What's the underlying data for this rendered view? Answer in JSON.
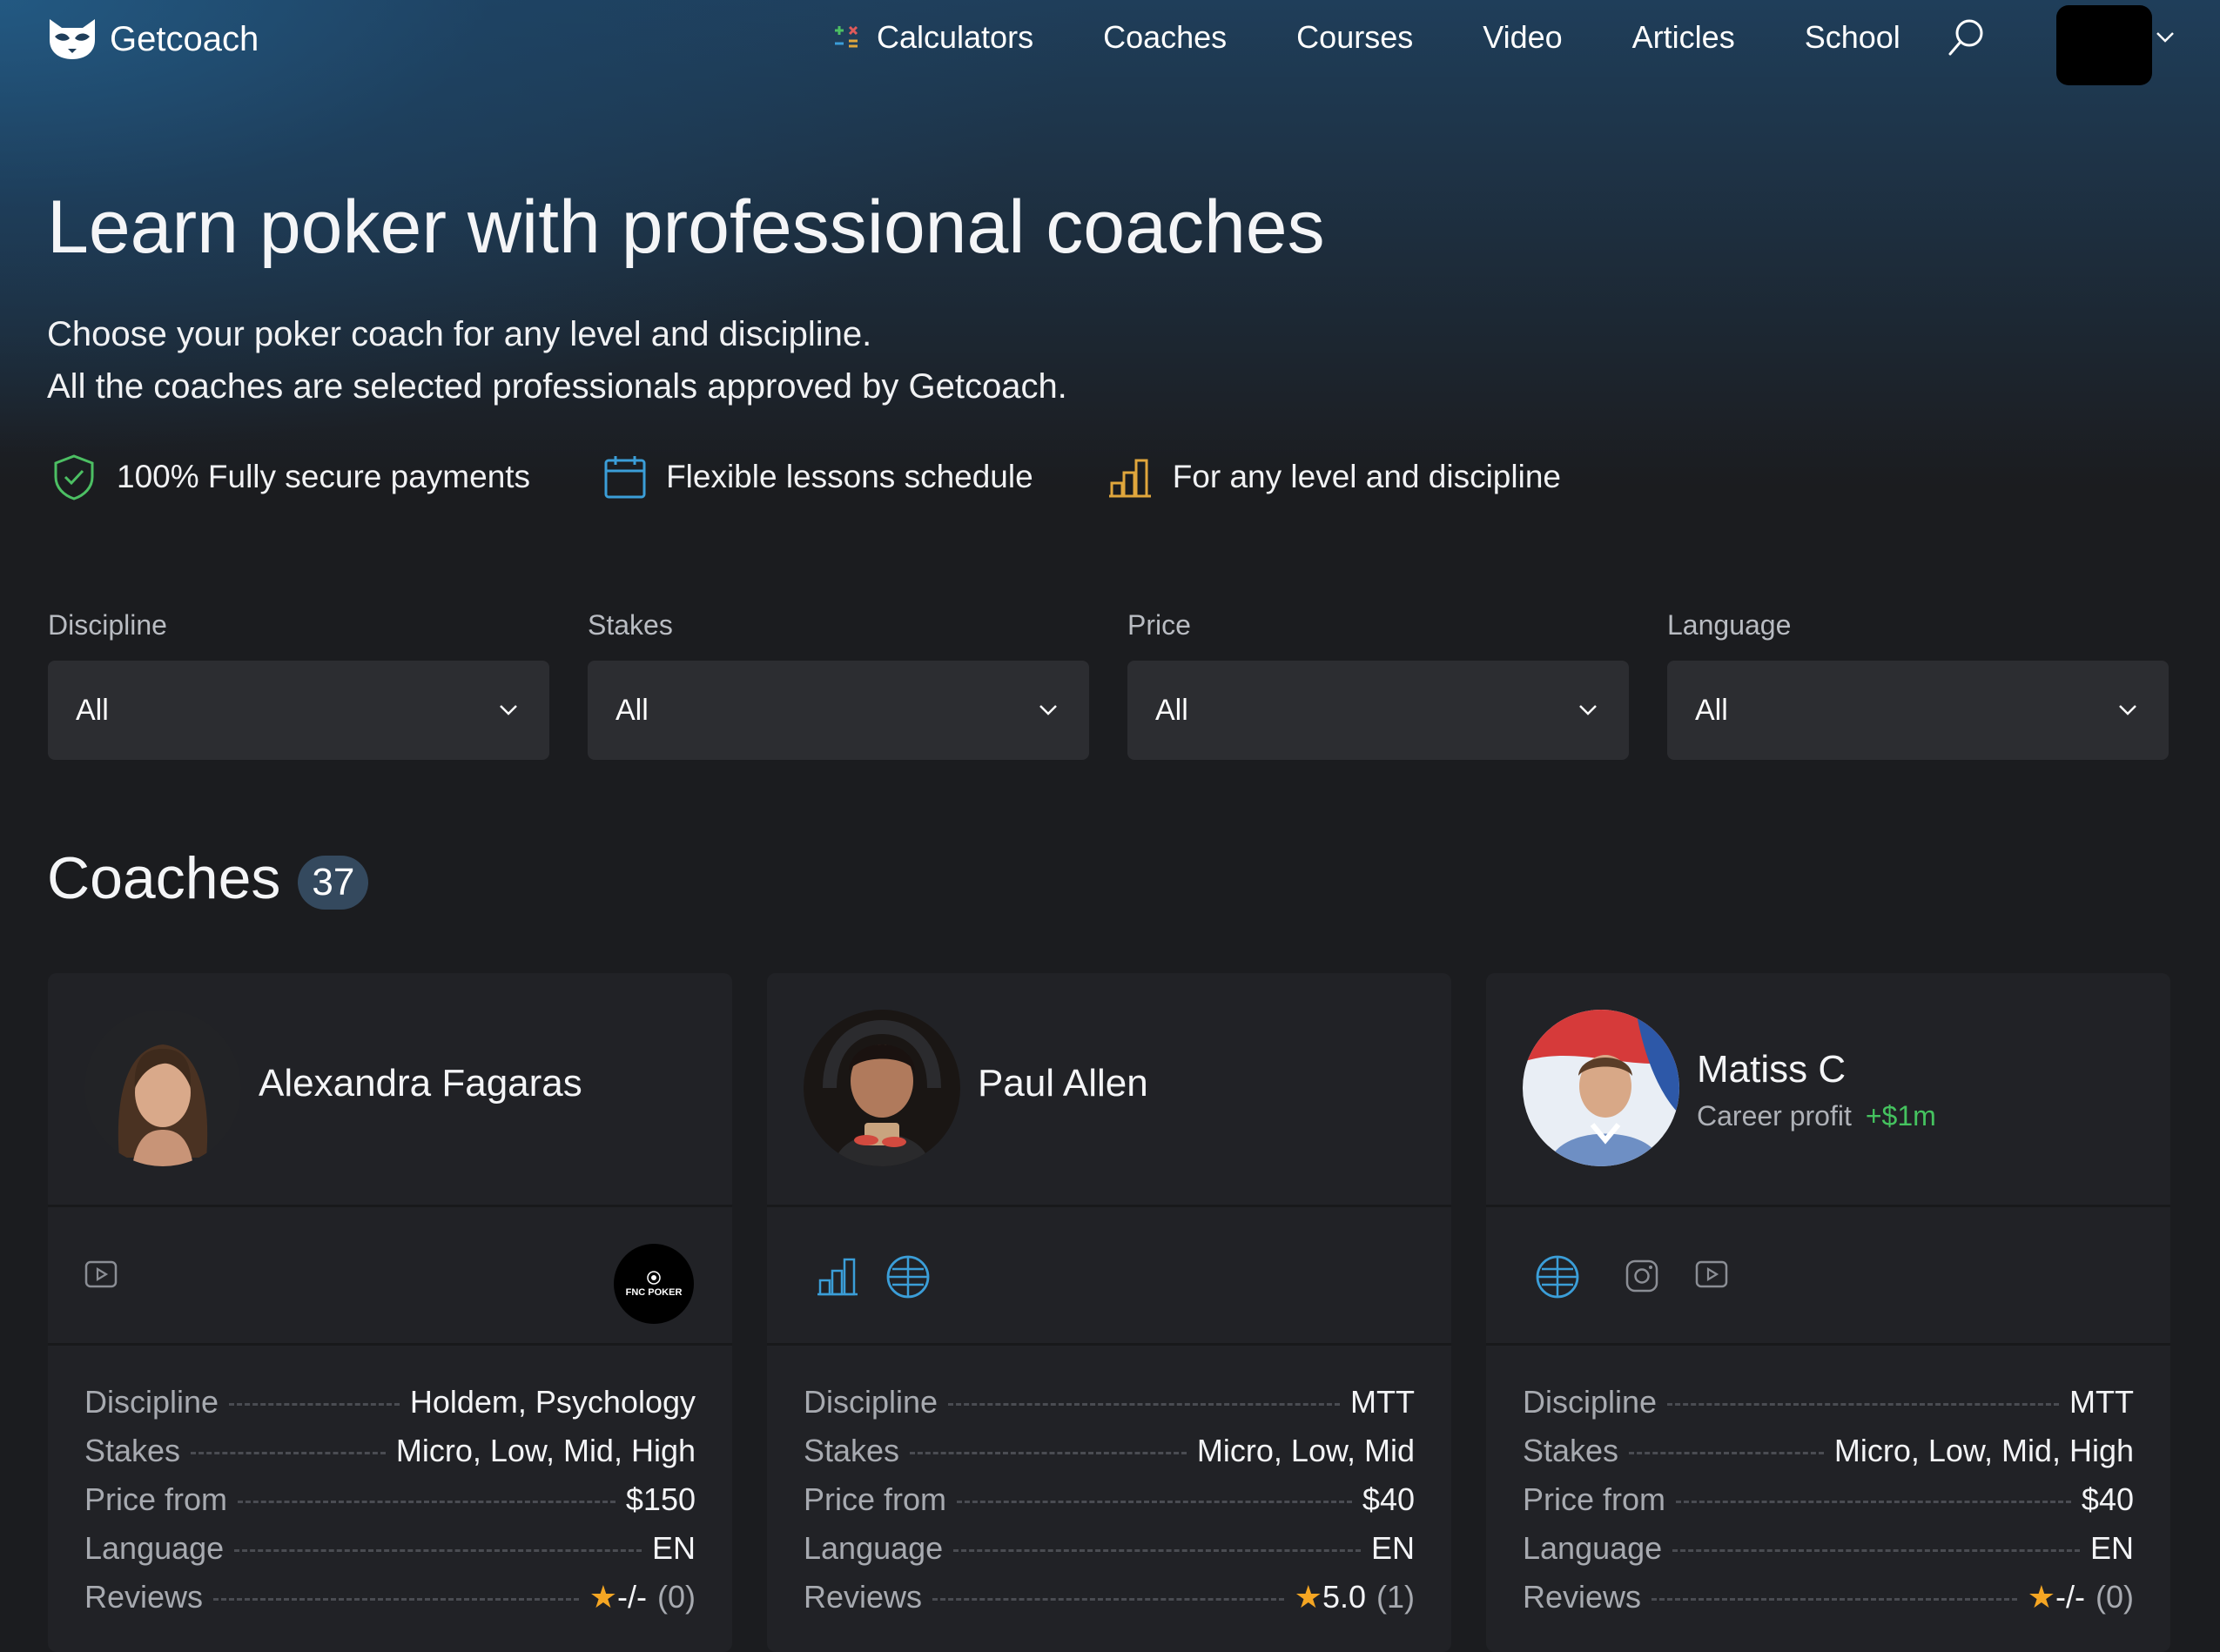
{
  "brand": {
    "name": "Getcoach"
  },
  "nav": {
    "items": [
      "Calculators",
      "Coaches",
      "Courses",
      "Video",
      "Articles",
      "School"
    ]
  },
  "hero": {
    "title": "Learn poker with professional coaches",
    "subtitle_line1": "Choose your poker coach for any level and discipline.",
    "subtitle_line2": "All the coaches are selected professionals approved by Getcoach.",
    "features": [
      "100% Fully secure payments",
      "Flexible lessons schedule",
      "For any level and discipline"
    ]
  },
  "filters": [
    {
      "label": "Discipline",
      "value": "All"
    },
    {
      "label": "Stakes",
      "value": "All"
    },
    {
      "label": "Price",
      "value": "All"
    },
    {
      "label": "Language",
      "value": "All"
    }
  ],
  "coaches": {
    "title": "Coaches",
    "count": "37",
    "row_labels": {
      "discipline": "Discipline",
      "stakes": "Stakes",
      "price": "Price from",
      "language": "Language",
      "reviews": "Reviews"
    },
    "cards": [
      {
        "name": "Alexandra Fagaras",
        "icons": [
          "youtube-icon",
          "fnc-poker-logo"
        ],
        "partner_logo_text": "FNC POKER",
        "discipline": "Holdem, Psychology",
        "stakes": "Micro, Low, Mid, High",
        "price": "$150",
        "language": "EN",
        "rating": "-/-",
        "review_count": "(0)"
      },
      {
        "name": "Paul Allen",
        "icons": [
          "stats-chart-icon",
          "globe-icon"
        ],
        "discipline": "MTT",
        "stakes": "Micro, Low, Mid",
        "price": "$40",
        "language": "EN",
        "rating": "5.0",
        "review_count": "(1)"
      },
      {
        "name": "Matiss C",
        "career_profit_label": "Career profit",
        "career_profit": "+$1m",
        "icons": [
          "globe-icon",
          "instagram-icon",
          "youtube-icon"
        ],
        "discipline": "MTT",
        "stakes": "Micro, Low, Mid, High",
        "price": "$40",
        "language": "EN",
        "rating": "-/-",
        "review_count": "(0)"
      }
    ]
  },
  "colors": {
    "background": "#1b1c1f",
    "card": "#212226",
    "accent_blue": "#3b9ed8",
    "profit_green": "#45c35f",
    "star": "#f5a623",
    "shield_green": "#4cbf63",
    "level_orange": "#e0a63c"
  }
}
